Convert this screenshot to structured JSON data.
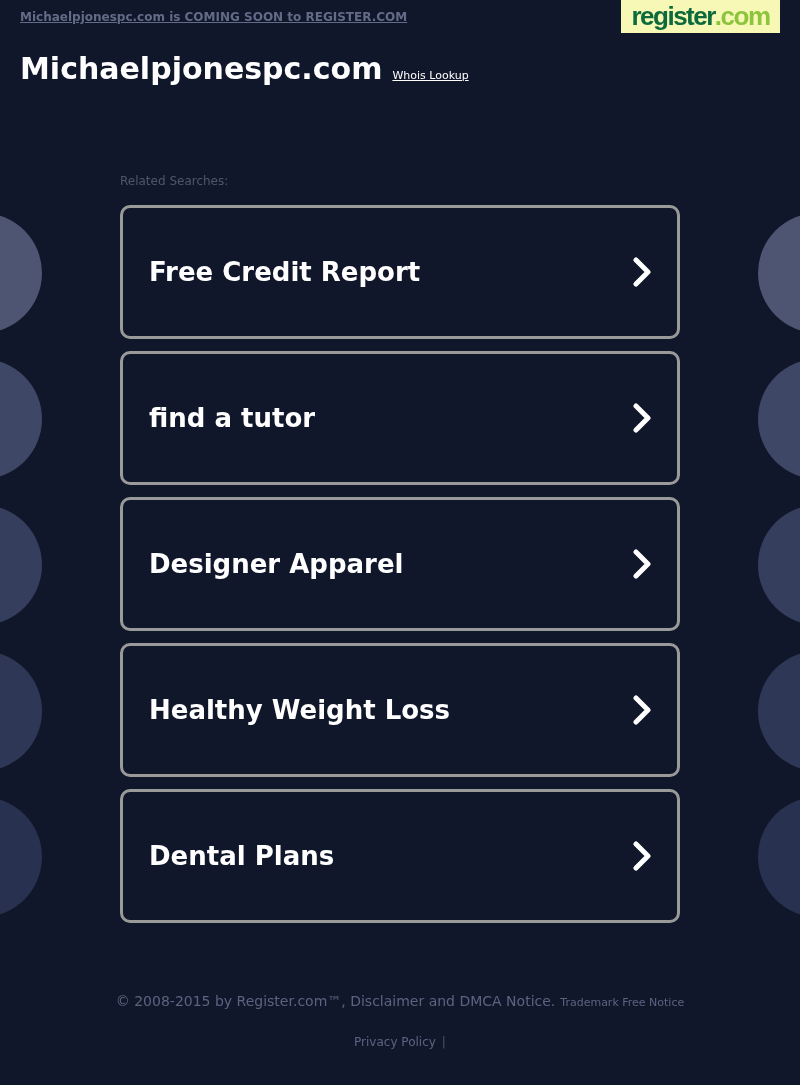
{
  "top_bar": {
    "notice_link": "Michaelpjonespc.com is COMING SOON to REGISTER.COM",
    "logo": {
      "brand": "register",
      "suffix": ".com"
    }
  },
  "header": {
    "domain": "Michaelpjonespc.com",
    "whois_link": "Whois Lookup"
  },
  "related": {
    "heading": "Related Searches:",
    "items": [
      {
        "label": "Free Credit Report"
      },
      {
        "label": "find a tutor"
      },
      {
        "label": "Designer Apparel"
      },
      {
        "label": "Healthy Weight Loss"
      },
      {
        "label": "Dental Plans"
      }
    ]
  },
  "footer": {
    "copyright": "© 2008-2015 by Register.com™, Disclaimer and DMCA Notice.",
    "trademark": "Trademark Free Notice",
    "privacy_link": "Privacy Policy",
    "separator": "|"
  }
}
